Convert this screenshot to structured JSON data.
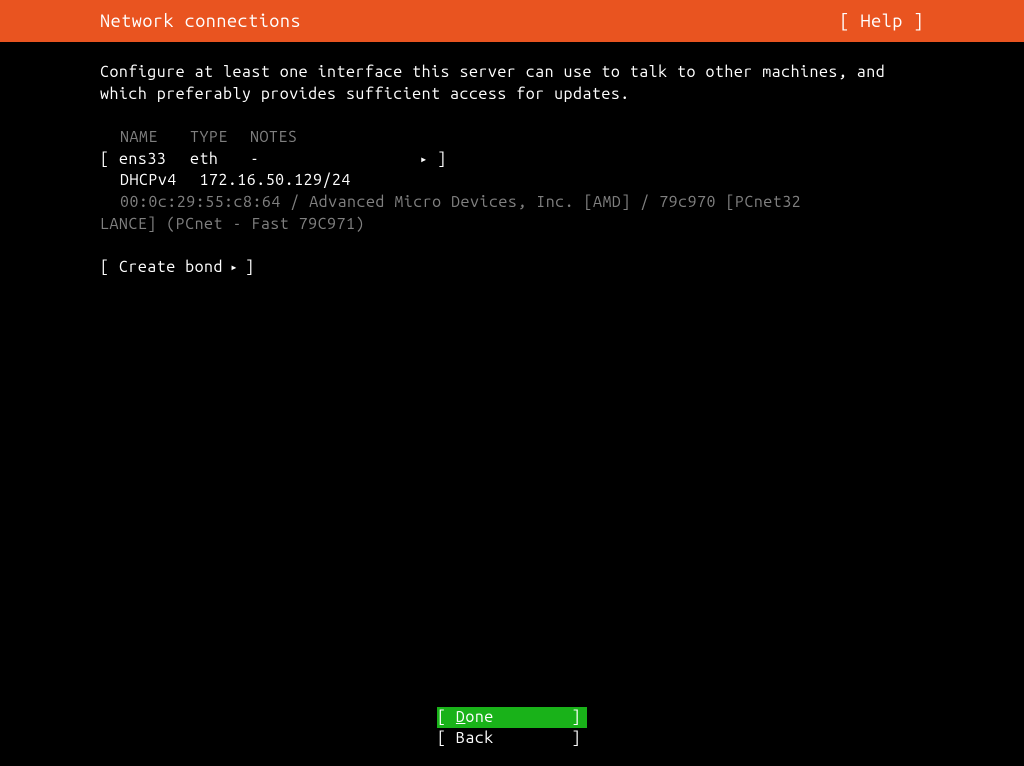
{
  "header": {
    "title": "Network connections",
    "help_label": "[ Help ]"
  },
  "description": "Configure at least one interface this server can use to talk to other machines, and which preferably provides sufficient access for updates.",
  "table": {
    "headers": {
      "name": "NAME",
      "type": "TYPE",
      "notes": "NOTES"
    }
  },
  "interface": {
    "open_bracket": "[",
    "name": "ens33",
    "type": "eth",
    "notes": "-",
    "arrow": "▸",
    "close_bracket": "]"
  },
  "dhcp": {
    "label": "DHCPv4",
    "address": "172.16.50.129/24"
  },
  "device": {
    "line1": "00:0c:29:55:c8:64 / Advanced Micro Devices, Inc. [AMD] / 79c970 [PCnet32",
    "line2": "LANCE] (PCnet - Fast 79C971)"
  },
  "create_bond": {
    "open": "[ ",
    "label": "Create bond",
    "arrow": " ▸ ",
    "close": "]"
  },
  "footer": {
    "done_open": "[ ",
    "done_first": "D",
    "done_rest": "one",
    "done_close": "]",
    "back_open": "[ ",
    "back_label": "Back",
    "back_close": "]"
  }
}
